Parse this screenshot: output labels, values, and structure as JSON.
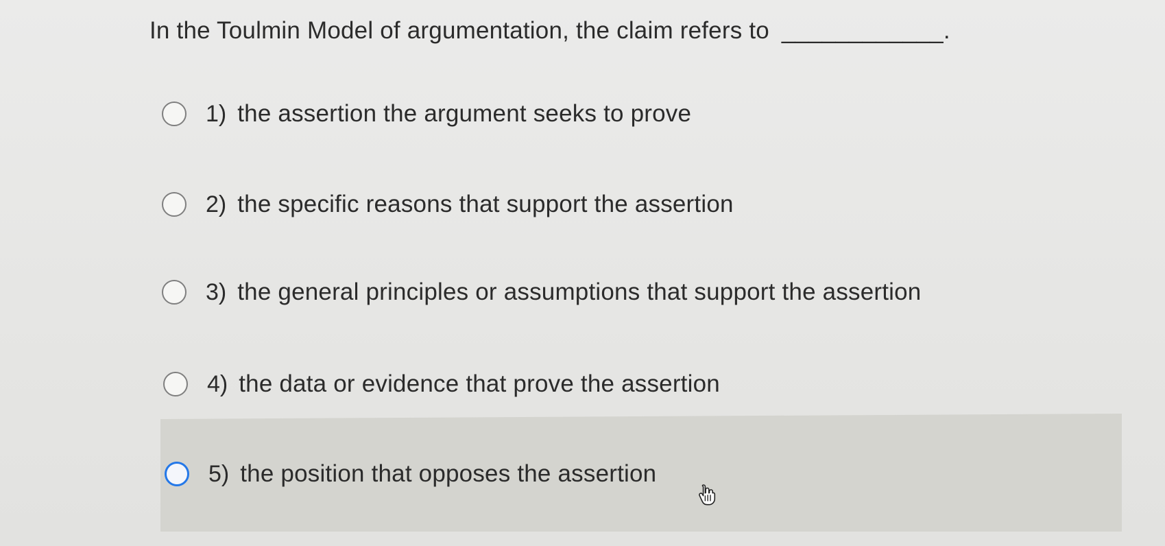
{
  "question": {
    "text": "In the Toulmin Model of argumentation, the claim refers to",
    "blank": "____________."
  },
  "options": [
    {
      "number": "1)",
      "label": "the assertion the argument seeks to prove"
    },
    {
      "number": "2)",
      "label": "the specific reasons that support the assertion"
    },
    {
      "number": "3)",
      "label": "the general principles or assumptions that support the assertion"
    },
    {
      "number": "4)",
      "label": "the data or evidence that prove the assertion"
    },
    {
      "number": "5)",
      "label": "the position that opposes the assertion"
    }
  ],
  "cursor": {
    "icon": "hand-pointer-icon"
  },
  "colors": {
    "background": "#e7e7e5",
    "highlight": "#d4d4cf",
    "focused_radio": "#2478e8"
  }
}
